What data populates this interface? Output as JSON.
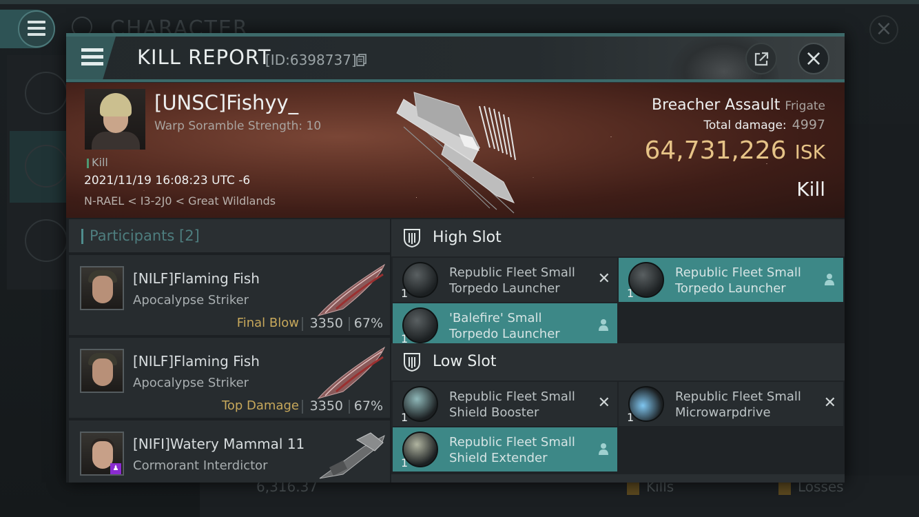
{
  "background": {
    "title": "CHARACTER",
    "bottom_value": "6,316.37",
    "bottom_kills": "Kills",
    "bottom_losses": "Losses"
  },
  "header": {
    "title": "KILL REPORT",
    "id_text": "[ID:6398737]"
  },
  "victim": {
    "name": "[UNSC]Fishyy_",
    "detail": "Warp Soramble Strength: 10",
    "kill_tag": "Kill",
    "time": "2021/11/19 16:08:23 UTC -6",
    "location": "N-RAEL < I3-2J0 < Great Wildlands",
    "ship_name": "Breacher Assault",
    "ship_class": "Frigate",
    "total_damage_label": "Total damage:",
    "total_damage": "4997",
    "isk_value": "64,731,226",
    "isk_unit": "ISK",
    "result": "Kill"
  },
  "participants": {
    "title": "Participants",
    "count": "[2]",
    "rows": [
      {
        "name": "[NILF]Flaming Fish",
        "ship": "Apocalypse Striker",
        "tag": "Final Blow",
        "damage": "3350",
        "percent": "67%"
      },
      {
        "name": "[NILF]Flaming Fish",
        "ship": "Apocalypse Striker",
        "tag": "Top Damage",
        "damage": "3350",
        "percent": "67%"
      },
      {
        "name": "[NIFI]Watery Mammal 11",
        "ship": "Cormorant Interdictor",
        "tag": "",
        "damage": "",
        "percent": ""
      }
    ]
  },
  "fitting": {
    "high_slot_title": "High Slot",
    "low_slot_title": "Low Slot",
    "high_modules": [
      {
        "qty": "1",
        "name": "Republic Fleet Small Torpedo Launcher",
        "state": "destroyed",
        "icon": "torpedo-launcher-icon"
      },
      {
        "qty": "1",
        "name": "Republic Fleet Small Torpedo Launcher",
        "state": "dropped",
        "icon": "torpedo-launcher-icon"
      },
      {
        "qty": "1",
        "name": "'Balefire' Small Torpedo Launcher",
        "state": "dropped",
        "icon": "torpedo-launcher-icon"
      }
    ],
    "low_modules": [
      {
        "qty": "1",
        "name": "Republic Fleet Small Shield Booster",
        "state": "destroyed",
        "icon": "shield-booster-icon"
      },
      {
        "qty": "1",
        "name": "Republic Fleet Small Microwarpdrive",
        "state": "destroyed",
        "icon": "microwarpdrive-icon"
      },
      {
        "qty": "1",
        "name": "Republic Fleet Small Shield Extender",
        "state": "dropped",
        "icon": "shield-extender-icon"
      }
    ]
  },
  "colors": {
    "accent_teal": "#3d8887",
    "isk_gold": "#e6c387",
    "final_blow": "#c7a85b"
  }
}
